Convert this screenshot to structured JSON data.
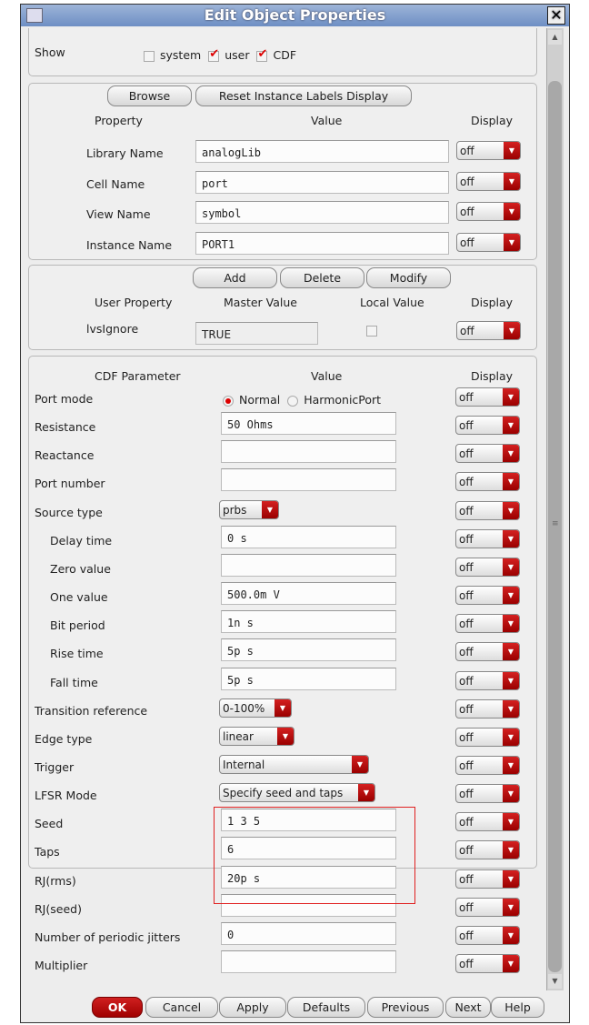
{
  "window": {
    "title": "Edit Object Properties"
  },
  "show": {
    "label": "Show",
    "options": [
      {
        "label": "system",
        "checked": false
      },
      {
        "label": "user",
        "checked": true
      },
      {
        "label": "CDF",
        "checked": true
      }
    ]
  },
  "props": {
    "browse": "Browse",
    "reset": "Reset Instance Labels Display",
    "headers": [
      "Property",
      "Value",
      "Display"
    ],
    "rows": [
      {
        "label": "Library Name",
        "value": "analogLib",
        "display": "off"
      },
      {
        "label": "Cell Name",
        "value": "port",
        "display": "off"
      },
      {
        "label": "View Name",
        "value": "symbol",
        "display": "off"
      },
      {
        "label": "Instance Name",
        "value": "PORT1",
        "display": "off"
      }
    ]
  },
  "user": {
    "add": "Add",
    "delete": "Delete",
    "modify": "Modify",
    "headers": [
      "User Property",
      "Master Value",
      "Local Value",
      "Display"
    ],
    "row": {
      "label": "lvsIgnore",
      "master": "TRUE",
      "local_checked": false,
      "display": "off"
    }
  },
  "cdf": {
    "headers": [
      "CDF Parameter",
      "Value",
      "Display"
    ],
    "rows": [
      {
        "label": "Port mode",
        "type": "radio",
        "options": [
          "Normal",
          "HarmonicPort"
        ],
        "selected": "Normal",
        "display": "off"
      },
      {
        "label": "Resistance",
        "type": "text",
        "value": "50 Ohms",
        "display": "off"
      },
      {
        "label": "Reactance",
        "type": "text",
        "value": "",
        "display": "off"
      },
      {
        "label": "Port number",
        "type": "text",
        "value": "",
        "display": "off"
      },
      {
        "label": "Source type",
        "type": "select",
        "value": "prbs",
        "display": "off"
      },
      {
        "label": "Delay time",
        "type": "text",
        "value": "0 s",
        "display": "off",
        "indent": true
      },
      {
        "label": "Zero value",
        "type": "text",
        "value": "",
        "display": "off",
        "indent": true
      },
      {
        "label": "One value",
        "type": "text",
        "value": "500.0m V",
        "display": "off",
        "indent": true
      },
      {
        "label": "Bit period",
        "type": "text",
        "value": "1n s",
        "display": "off",
        "indent": true
      },
      {
        "label": "Rise time",
        "type": "text",
        "value": "5p s",
        "display": "off",
        "indent": true
      },
      {
        "label": "Fall time",
        "type": "text",
        "value": "5p s",
        "display": "off",
        "indent": true
      },
      {
        "label": "Transition reference",
        "type": "select",
        "value": "0-100%",
        "display": "off"
      },
      {
        "label": "Edge type",
        "type": "select",
        "value": "linear",
        "display": "off"
      },
      {
        "label": "Trigger",
        "type": "select",
        "value": "Internal",
        "display": "off"
      },
      {
        "label": "LFSR Mode",
        "type": "select",
        "value": "Specify seed and taps",
        "display": "off"
      },
      {
        "label": "Seed",
        "type": "text",
        "value": "1 3 5",
        "display": "off"
      },
      {
        "label": "Taps",
        "type": "text",
        "value": "6",
        "display": "off"
      },
      {
        "label": "RJ(rms)",
        "type": "text",
        "value": "20p s",
        "display": "off"
      },
      {
        "label": "RJ(seed)",
        "type": "text",
        "value": "",
        "display": "off"
      },
      {
        "label": "Number of periodic jitters",
        "type": "text",
        "value": "0",
        "display": "off"
      },
      {
        "label": "Multiplier",
        "type": "text",
        "value": "",
        "display": "off"
      }
    ]
  },
  "footer": {
    "buttons": [
      "OK",
      "Cancel",
      "Apply",
      "Defaults",
      "Previous",
      "Next",
      "Help"
    ]
  },
  "colors": {
    "accent": "#b00000",
    "highlight": "#e02020"
  }
}
